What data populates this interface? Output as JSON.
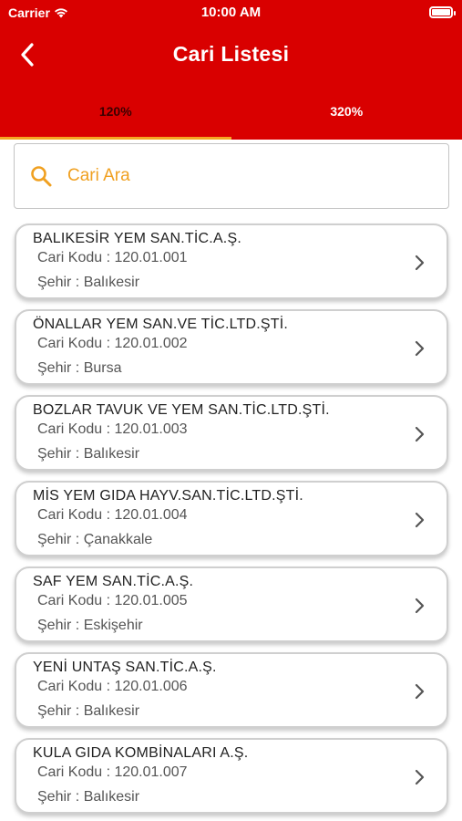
{
  "status_bar": {
    "carrier": "Carrier",
    "time": "10:00 AM"
  },
  "nav": {
    "title": "Cari Listesi",
    "back_icon": "chevron-left-icon"
  },
  "tabs": [
    {
      "label": "120%",
      "active": true
    },
    {
      "label": "320%",
      "active": false
    }
  ],
  "search": {
    "placeholder": "Cari Ara",
    "value": "",
    "icon": "search-icon"
  },
  "colors": {
    "header": "#d90000",
    "accent": "#f5a623",
    "search_text": "#f0a020"
  },
  "accounts": [
    {
      "name": "BALIKESİR YEM SAN.TİC.A.Ş.",
      "code": "Cari Kodu : 120.01.001",
      "city": "Şehir : Balıkesir"
    },
    {
      "name": "ÖNALLAR YEM SAN.VE TİC.LTD.ŞTİ.",
      "code": "Cari Kodu : 120.01.002",
      "city": "Şehir : Bursa"
    },
    {
      "name": "BOZLAR TAVUK VE YEM SAN.TİC.LTD.ŞTİ.",
      "code": "Cari Kodu : 120.01.003",
      "city": "Şehir : Balıkesir"
    },
    {
      "name": "MİS YEM GIDA HAYV.SAN.TİC.LTD.ŞTİ.",
      "code": "Cari Kodu : 120.01.004",
      "city": "Şehir : Çanakkale"
    },
    {
      "name": "SAF YEM SAN.TİC.A.Ş.",
      "code": "Cari Kodu : 120.01.005",
      "city": "Şehir : Eskişehir"
    },
    {
      "name": "YENİ UNTAŞ SAN.TİC.A.Ş.",
      "code": "Cari Kodu : 120.01.006",
      "city": "Şehir : Balıkesir"
    },
    {
      "name": "KULA GIDA KOMBİNALARI A.Ş.",
      "code": "Cari Kodu : 120.01.007",
      "city": "Şehir : Balıkesir"
    }
  ]
}
